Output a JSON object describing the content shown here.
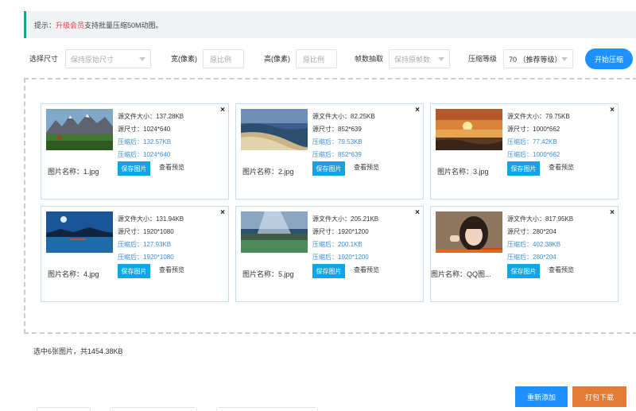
{
  "notice": {
    "prefix": "提示：",
    "vip_link": "升级会员",
    "suffix": "支持批量压缩50M动图。"
  },
  "toolbar": {
    "size_label": "选择尺寸",
    "size_value": "保持原始尺寸",
    "width_label": "宽(像素)",
    "width_placeholder": "原比例",
    "height_label": "高(像素)",
    "height_placeholder": "原比例",
    "frame_label": "帧数抽取",
    "frame_value": "保持原帧数",
    "level_label": "压缩等级",
    "level_value": "70 （推荐等级）",
    "start_label": "开始压缩"
  },
  "cards": [
    {
      "name": "图片名称：1.jpg",
      "src_size": "源文件大小：137.28KB",
      "src_dim": "源尺寸：1024*640",
      "cmp_size": "压缩后：132.57KB",
      "cmp_dim": "压缩后：1024*640",
      "save_label": "保存图片",
      "preview_label": "查看预览",
      "close": "×",
      "thumb": "mountain-lake-thumbnail"
    },
    {
      "name": "图片名称：2.jpg",
      "src_size": "源文件大小：82.25KB",
      "src_dim": "源尺寸：852*639",
      "cmp_size": "压缩后：79.53KB",
      "cmp_dim": "压缩后：852*639",
      "save_label": "保存图片",
      "preview_label": "查看预览",
      "close": "×",
      "thumb": "coast-beach-thumbnail"
    },
    {
      "name": "图片名称：3.jpg",
      "src_size": "源文件大小：79.75KB",
      "src_dim": "源尺寸：1000*662",
      "cmp_size": "压缩后：77.42KB",
      "cmp_dim": "压缩后：1000*662",
      "save_label": "保存图片",
      "preview_label": "查看预览",
      "close": "×",
      "thumb": "sunset-sea-thumbnail"
    },
    {
      "name": "图片名称：4.jpg",
      "src_size": "源文件大小：131.94KB",
      "src_dim": "源尺寸：1920*1080",
      "cmp_size": "压缩后：127.93KB",
      "cmp_dim": "压缩后：1920*1080",
      "save_label": "保存图片",
      "preview_label": "查看预览",
      "close": "×",
      "thumb": "night-sky-lake-thumbnail"
    },
    {
      "name": "图片名称：5.jpg",
      "src_size": "源文件大小：205.21KB",
      "src_dim": "源尺寸：1920*1200",
      "cmp_size": "压缩后：200.1KB",
      "cmp_dim": "压缩后：1920*1200",
      "save_label": "保存图片",
      "preview_label": "查看预览",
      "close": "×",
      "thumb": "sunbeam-lake-thumbnail"
    },
    {
      "name": "图片名称：QQ图...",
      "src_size": "源文件大小：817.95KB",
      "src_dim": "源尺寸：280*204",
      "cmp_size": "压缩后：402.38KB",
      "cmp_dim": "压缩后：280*204",
      "save_label": "保存图片",
      "preview_label": "查看预览",
      "close": "×",
      "thumb": "girl-photo-thumbnail"
    }
  ],
  "summary": "选中6张图片，共1454.38KB",
  "actions": {
    "readd_label": "重新添加",
    "download_label": "打包下载"
  },
  "colors": {
    "primary": "#1e90ff",
    "accent": "#e37a35",
    "notice_bar": "#1aa38a",
    "vip": "#e8384f",
    "compressed_text": "#3a8fd8"
  }
}
